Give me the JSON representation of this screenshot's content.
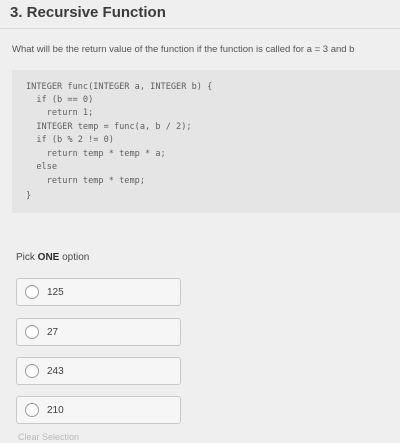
{
  "question": {
    "title": "3. Recursive Function",
    "text": "What will be the return value of the function if the function is called for a = 3 and b"
  },
  "code": {
    "lines": [
      "INTEGER func(INTEGER a, INTEGER b) {",
      "  if (b == 0)",
      "    return 1;",
      "  INTEGER temp = func(a, b / 2);",
      "  if (b % 2 != 0)",
      "    return temp * temp * a;",
      "  else",
      "    return temp * temp;",
      "}"
    ]
  },
  "answer": {
    "pick_prefix": "Pick ",
    "pick_bold": "ONE",
    "pick_suffix": " option",
    "options": [
      {
        "label": "125",
        "selected": false
      },
      {
        "label": "27",
        "selected": false
      },
      {
        "label": "243",
        "selected": false
      },
      {
        "label": "210",
        "selected": false
      }
    ],
    "clear_label": "Clear Selection"
  }
}
